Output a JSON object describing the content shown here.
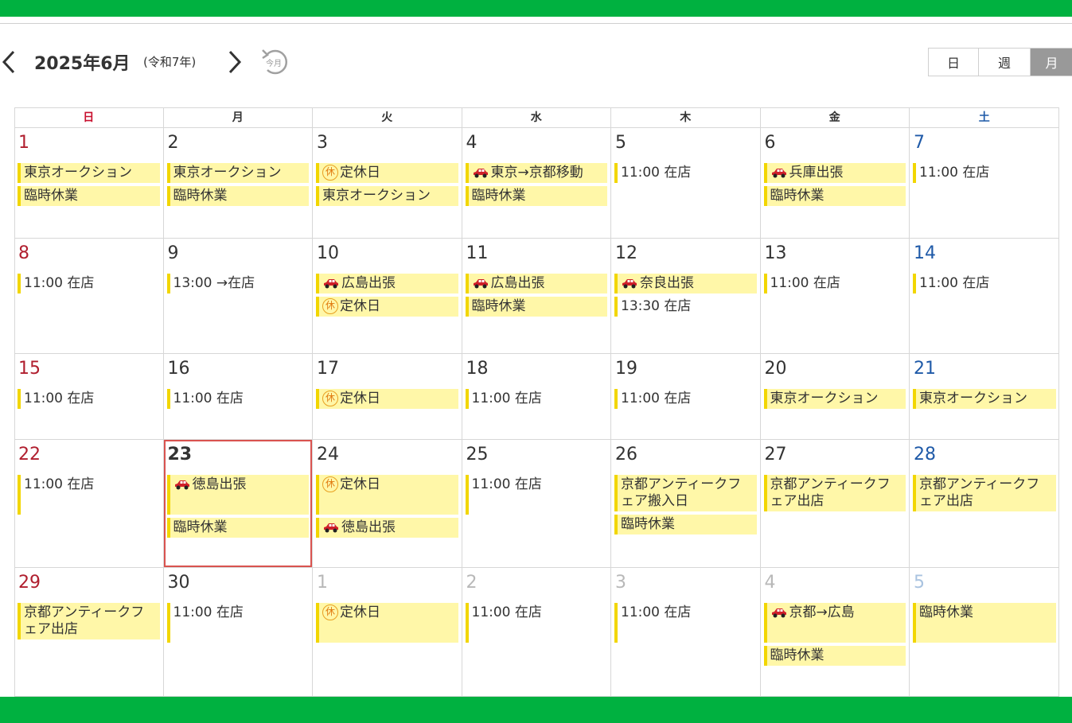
{
  "header": {
    "title": "2025年6月",
    "era": "(令和7年)",
    "today_label": "今月"
  },
  "views": [
    {
      "label": "日",
      "active": false
    },
    {
      "label": "週",
      "active": false
    },
    {
      "label": "月",
      "active": true
    }
  ],
  "weekdays": [
    "日",
    "月",
    "火",
    "水",
    "木",
    "金",
    "土"
  ],
  "weeks": [
    [
      {
        "day": "1",
        "events": [
          {
            "text": "東京オークション",
            "hl": true
          },
          {
            "text": "臨時休業",
            "hl": true
          }
        ]
      },
      {
        "day": "2",
        "events": [
          {
            "text": "東京オークション",
            "hl": true
          },
          {
            "text": "臨時休業",
            "hl": true
          }
        ]
      },
      {
        "day": "3",
        "events": [
          {
            "text": "定休日",
            "hl": true,
            "icon": "holiday-icon",
            "icon_text": "休"
          },
          {
            "text": "東京オークション",
            "hl": true
          }
        ]
      },
      {
        "day": "4",
        "events": [
          {
            "text": "東京→京都移動",
            "hl": true,
            "icon": "car-icon"
          },
          {
            "text": "臨時休業",
            "hl": true
          }
        ]
      },
      {
        "day": "5",
        "events": [
          {
            "text": "11:00 在店",
            "hl": false
          }
        ]
      },
      {
        "day": "6",
        "events": [
          {
            "text": "兵庫出張",
            "hl": true,
            "icon": "car-icon"
          },
          {
            "text": "臨時休業",
            "hl": true
          }
        ]
      },
      {
        "day": "7",
        "events": [
          {
            "text": "11:00 在店",
            "hl": false
          }
        ]
      }
    ],
    [
      {
        "day": "8",
        "events": [
          {
            "text": "11:00 在店",
            "hl": false
          }
        ]
      },
      {
        "day": "9",
        "events": [
          {
            "text": "13:00 →在店",
            "hl": false
          }
        ]
      },
      {
        "day": "10",
        "events": [
          {
            "text": "広島出張",
            "hl": true,
            "icon": "car-icon"
          },
          {
            "text": "定休日",
            "hl": true,
            "icon": "holiday-icon",
            "icon_text": "休"
          }
        ]
      },
      {
        "day": "11",
        "events": [
          {
            "text": "広島出張",
            "hl": true,
            "icon": "car-icon"
          },
          {
            "text": "臨時休業",
            "hl": true
          }
        ]
      },
      {
        "day": "12",
        "events": [
          {
            "text": "奈良出張",
            "hl": true,
            "icon": "car-icon"
          },
          {
            "text": "13:30 在店",
            "hl": false
          }
        ]
      },
      {
        "day": "13",
        "events": [
          {
            "text": "11:00 在店",
            "hl": false
          }
        ]
      },
      {
        "day": "14",
        "events": [
          {
            "text": "11:00 在店",
            "hl": false
          }
        ]
      }
    ],
    [
      {
        "day": "15",
        "events": [
          {
            "text": "11:00 在店",
            "hl": false
          }
        ]
      },
      {
        "day": "16",
        "events": [
          {
            "text": "11:00 在店",
            "hl": false
          }
        ]
      },
      {
        "day": "17",
        "events": [
          {
            "text": "定休日",
            "hl": true,
            "icon": "holiday-icon",
            "icon_text": "休"
          }
        ]
      },
      {
        "day": "18",
        "events": [
          {
            "text": "11:00 在店",
            "hl": false
          }
        ]
      },
      {
        "day": "19",
        "events": [
          {
            "text": "11:00 在店",
            "hl": false
          }
        ]
      },
      {
        "day": "20",
        "events": [
          {
            "text": "東京オークション",
            "hl": true
          }
        ]
      },
      {
        "day": "21",
        "events": [
          {
            "text": "東京オークション",
            "hl": true
          }
        ]
      }
    ],
    [
      {
        "day": "22",
        "events": [
          {
            "text": "11:00 在店",
            "hl": false,
            "tall": true
          }
        ]
      },
      {
        "day": "23",
        "today": true,
        "events": [
          {
            "text": "徳島出張",
            "hl": true,
            "icon": "car-icon",
            "tall": true
          },
          {
            "text": "臨時休業",
            "hl": true
          }
        ]
      },
      {
        "day": "24",
        "events": [
          {
            "text": "定休日",
            "hl": true,
            "icon": "holiday-icon",
            "icon_text": "休",
            "tall": true
          },
          {
            "text": "徳島出張",
            "hl": true,
            "icon": "car-icon"
          }
        ]
      },
      {
        "day": "25",
        "events": [
          {
            "text": "11:00 在店",
            "hl": false,
            "tall": true
          }
        ]
      },
      {
        "day": "26",
        "events": [
          {
            "text": "京都アンティークフェア搬入日",
            "hl": true
          },
          {
            "text": "臨時休業",
            "hl": true
          }
        ]
      },
      {
        "day": "27",
        "events": [
          {
            "text": "京都アンティークフェア出店",
            "hl": true
          }
        ]
      },
      {
        "day": "28",
        "events": [
          {
            "text": "京都アンティークフェア出店",
            "hl": true
          }
        ]
      }
    ],
    [
      {
        "day": "29",
        "events": [
          {
            "text": "京都アンティークフェア出店",
            "hl": true
          }
        ]
      },
      {
        "day": "30",
        "events": [
          {
            "text": "11:00 在店",
            "hl": false,
            "tall": true
          }
        ]
      },
      {
        "day": "1",
        "other": true,
        "events": [
          {
            "text": "定休日",
            "hl": true,
            "icon": "holiday-icon",
            "icon_text": "休",
            "tall": true
          }
        ]
      },
      {
        "day": "2",
        "other": true,
        "events": [
          {
            "text": "11:00 在店",
            "hl": false,
            "tall": true
          }
        ]
      },
      {
        "day": "3",
        "other": true,
        "events": [
          {
            "text": "11:00 在店",
            "hl": false,
            "tall": true
          }
        ]
      },
      {
        "day": "4",
        "other": true,
        "events": [
          {
            "text": "京都→広島",
            "hl": true,
            "icon": "car-icon",
            "tall": true
          },
          {
            "text": "臨時休業",
            "hl": true
          }
        ]
      },
      {
        "day": "5",
        "other": true,
        "events": [
          {
            "text": "臨時休業",
            "hl": true,
            "tall": true
          }
        ]
      }
    ]
  ]
}
